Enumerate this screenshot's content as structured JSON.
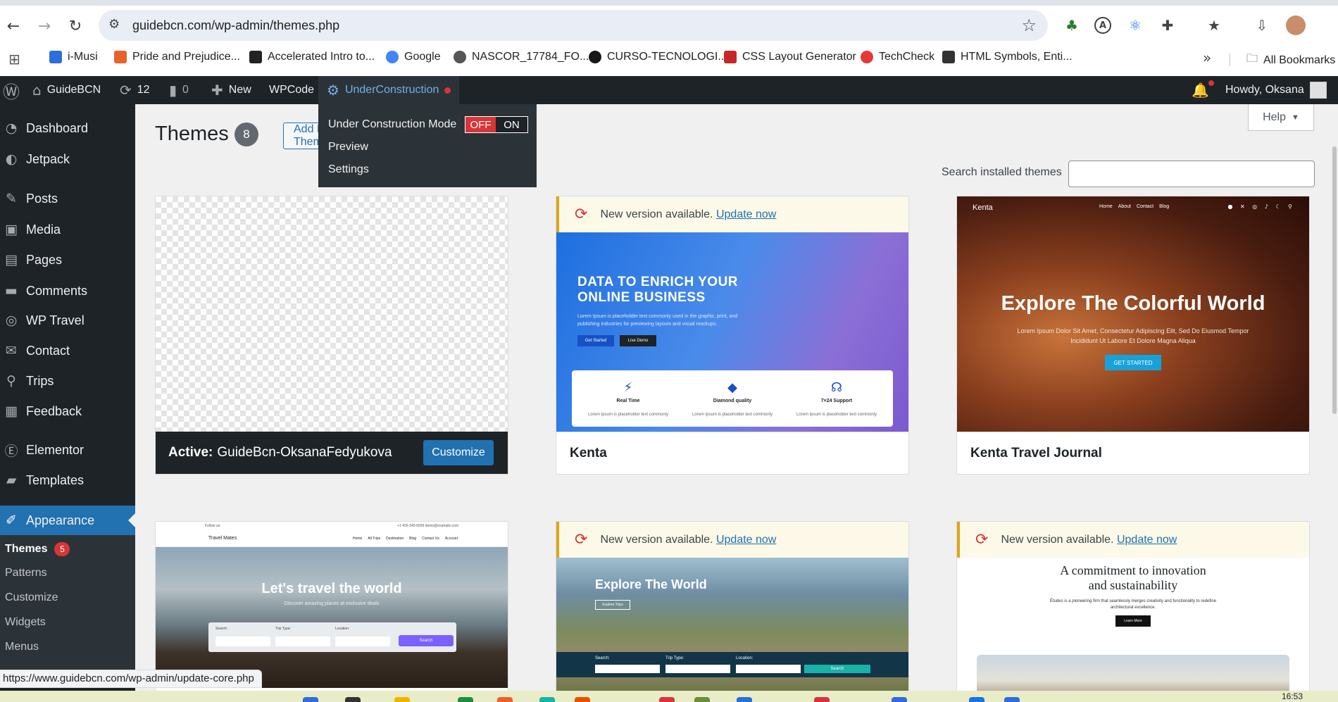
{
  "browser": {
    "url": "guidebcn.com/wp-admin/themes.php",
    "bookmarks": [
      {
        "label": "i-Musi",
        "color": "#2d6fd6"
      },
      {
        "label": "Pride and Prejudice...",
        "color": "#e8622c"
      },
      {
        "label": "Accelerated Intro to...",
        "color": "#222222"
      },
      {
        "label": "Google",
        "color": "#4285f4"
      },
      {
        "label": "NASCOR_17784_FO...",
        "color": "#555555"
      },
      {
        "label": "CURSO-TECNOLOGI...",
        "color": "#181717"
      },
      {
        "label": "CSS Layout Generator",
        "color": "#c62828"
      },
      {
        "label": "TechCheck",
        "color": "#e53935"
      },
      {
        "label": "HTML Symbols, Enti...",
        "color": "#333333"
      }
    ],
    "all_bookmarks": "All Bookmarks",
    "status_url": "https://www.guidebcn.com/wp-admin/update-core.php",
    "clock": "16:53"
  },
  "adminbar": {
    "site_name": "GuideBCN",
    "updates_count": "12",
    "comments_count": "0",
    "new_label": "New",
    "wpcode_label": "WPCode",
    "uc_label": "UnderConstruction",
    "howdy": "Howdy, Oksana"
  },
  "uc_dropdown": {
    "mode_label": "Under Construction Mode",
    "off": "OFF",
    "on": "ON",
    "preview": "Preview",
    "settings": "Settings"
  },
  "sidebar": {
    "items": [
      {
        "label": "Dashboard",
        "icon": "dashboard-icon"
      },
      {
        "label": "Jetpack",
        "icon": "jetpack-icon"
      },
      {
        "label": "Posts",
        "icon": "pin-icon"
      },
      {
        "label": "Media",
        "icon": "media-icon"
      },
      {
        "label": "Pages",
        "icon": "pages-icon"
      },
      {
        "label": "Comments",
        "icon": "comments-icon"
      },
      {
        "label": "WP Travel",
        "icon": "compass-icon"
      },
      {
        "label": "Contact",
        "icon": "mail-icon"
      },
      {
        "label": "Trips",
        "icon": "location-icon"
      },
      {
        "label": "Feedback",
        "icon": "feedback-icon"
      },
      {
        "label": "Elementor",
        "icon": "elementor-icon"
      },
      {
        "label": "Templates",
        "icon": "folder-icon"
      },
      {
        "label": "Appearance",
        "icon": "brush-icon"
      }
    ],
    "submenu": {
      "themes": "Themes",
      "themes_badge": "5",
      "patterns": "Patterns",
      "customize": "Customize",
      "widgets": "Widgets",
      "menus": "Menus"
    }
  },
  "content": {
    "title": "Themes",
    "count": "8",
    "add_new": "Add New Theme",
    "help": "Help",
    "search_label": "Search installed themes",
    "update_text": "New version available.",
    "update_link": "Update now",
    "themes": {
      "active": {
        "prefix": "Active:",
        "name": "GuideBcn-OksanaFedyukova",
        "customize": "Customize"
      },
      "kenta": {
        "name": "Kenta",
        "heading": "DATA TO ENRICH YOUR ONLINE BUSINESS",
        "para": "Lorem Ipsum is placeholder text commonly used in the graphic, print, and publishing industries for previewing layouts and visual mockups.",
        "btn1": "Get Started",
        "btn2": "Live Demo",
        "features": [
          {
            "title": "Real Time",
            "desc": "Lorem Ipsum is placeholder text commonly"
          },
          {
            "title": "Diamond quality",
            "desc": "Lorem Ipsum is placeholder text commonly"
          },
          {
            "title": "7×24 Support",
            "desc": "Lorem Ipsum is placeholder text commonly"
          }
        ]
      },
      "ktj": {
        "name": "Kenta Travel Journal",
        "logo": "Kenta",
        "nav": [
          "Home",
          "About",
          "Contact",
          "Blog"
        ],
        "heading": "Explore The Colorful World",
        "para": "Lorem Ipsum Dolor Sit Amet, Consectetur Adipiscing Elit, Sed Do Eiusmod Tempor Incididunt Ut Labore Et Dolore Magna Aliqua",
        "btn": "GET STARTED"
      },
      "travelmates": {
        "top_left": "Follow us:",
        "top_right": "+1 426-349-6659   demo@example.com",
        "logo": "Travel Mates",
        "nav": [
          "Home",
          "All Trips",
          "Destination",
          "Blog",
          "Contact Us",
          "Account"
        ],
        "heading": "Let's travel the world",
        "sub": "Discover amazing places at exclusive deals",
        "fields": [
          "Search:",
          "Trip Type:",
          "Location:"
        ],
        "search_btn": "Search"
      },
      "explore": {
        "heading": "Explore The World",
        "btn": "Explore Trips",
        "fields": [
          "Search:",
          "Trip Type:",
          "Location:"
        ],
        "search_btn": "Search"
      },
      "etudes": {
        "heading_1": "A commitment to innovation",
        "heading_2": "and sustainability",
        "para": "Études is a pioneering firm that seamlessly merges creativity and functionality to redefine architectural excellence.",
        "btn": "Learn More"
      }
    }
  }
}
